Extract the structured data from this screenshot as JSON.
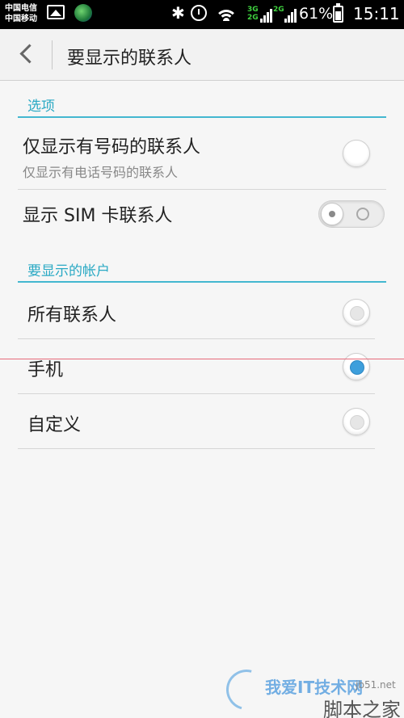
{
  "statusbar": {
    "carrier1": "中国电信",
    "carrier2": "中国移动",
    "net1": "3G\n2G",
    "net2": "2G",
    "battery": "61%",
    "time": "15:11",
    "icons": [
      "gallery-icon",
      "globe-icon",
      "bluetooth-icon",
      "alarm-icon",
      "wifi-icon",
      "signal-icon",
      "battery-icon"
    ]
  },
  "header": {
    "title": "要显示的联系人",
    "back_icon": "back-chevron-icon"
  },
  "options_section": {
    "title": "选项",
    "items": [
      {
        "label": "仅显示有号码的联系人",
        "sublabel": "仅显示有电话号码的联系人",
        "state": "unchecked"
      },
      {
        "label": "显示 SIM 卡联系人",
        "state": "off"
      }
    ]
  },
  "accounts_section": {
    "title": "要显示的帐户",
    "items": [
      {
        "label": "所有联系人",
        "state": "unselected"
      },
      {
        "label": "手机",
        "state": "selected"
      },
      {
        "label": "自定义",
        "state": "unselected"
      }
    ]
  },
  "colors": {
    "accent": "#2aa9c4",
    "selected_radio": "#3d9fdc",
    "status_bar": "#000000",
    "annotation_line": "#e76a7a"
  },
  "watermark": {
    "text1": "我爱IT技术网",
    "text2": "jb51.net",
    "text3": "脚本之家"
  }
}
